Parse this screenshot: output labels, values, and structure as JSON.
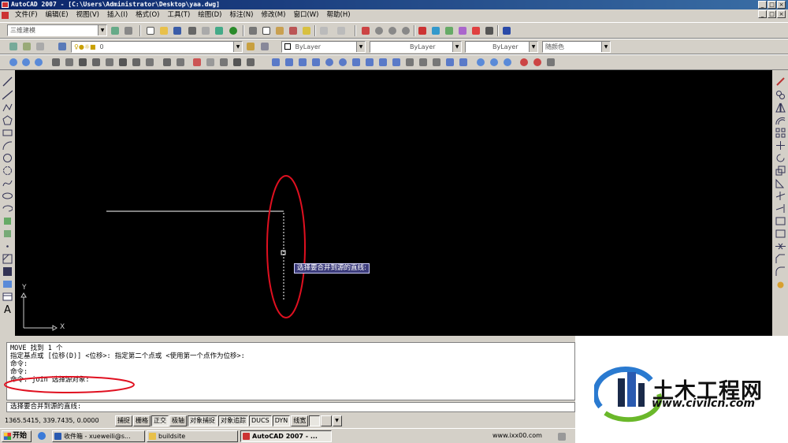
{
  "window": {
    "title": "AutoCAD 2007 - [C:\\Users\\Administrator\\Desktop\\yaa.dwg]",
    "controls": [
      "_",
      "□",
      "×"
    ]
  },
  "menu": [
    "文件(F)",
    "编辑(E)",
    "视图(V)",
    "插入(I)",
    "格式(O)",
    "工具(T)",
    "绘图(D)",
    "标注(N)",
    "修改(M)",
    "窗口(W)",
    "帮助(H)"
  ],
  "toolbars": {
    "workspace": "三维建模",
    "layer": "0",
    "color": "ByLayer",
    "linetype": "ByLayer",
    "lineweight": "ByLayer",
    "plotstyle": "随颜色"
  },
  "canvas": {
    "tooltip": "选择要合并到源的直线:",
    "ucs_x": "X",
    "ucs_y": "Y",
    "colors": {
      "background": "#000000",
      "line": "#ffffff",
      "highlight": "#e01020"
    }
  },
  "command": {
    "history": [
      "MOVE 找到 1 个",
      "指定基点或 [位移(D)] <位移>:  指定第二个点或 <使用第一个点作为位移>:",
      "命令:",
      "命令:",
      "命令:  join 选择源对象:"
    ],
    "prompt": "选择要合并到源的直线:"
  },
  "status": {
    "coords": "1365.5415, 339.7435, 0.0000",
    "buttons": [
      "捕捉",
      "栅格",
      "正交",
      "极轴",
      "对象捕捉",
      "对象追踪",
      "DUCS",
      "DYN",
      "线宽"
    ]
  },
  "taskbar": {
    "start": "开始",
    "tasks": [
      {
        "label": "收件箱 - xueweili@s..."
      },
      {
        "label": "buildsite"
      },
      {
        "label": "AutoCAD 2007 - ..."
      }
    ],
    "tray_text": "www.ixx00.com"
  },
  "watermark": {
    "title": "土木工程网",
    "url": "www.civilcn.com"
  }
}
